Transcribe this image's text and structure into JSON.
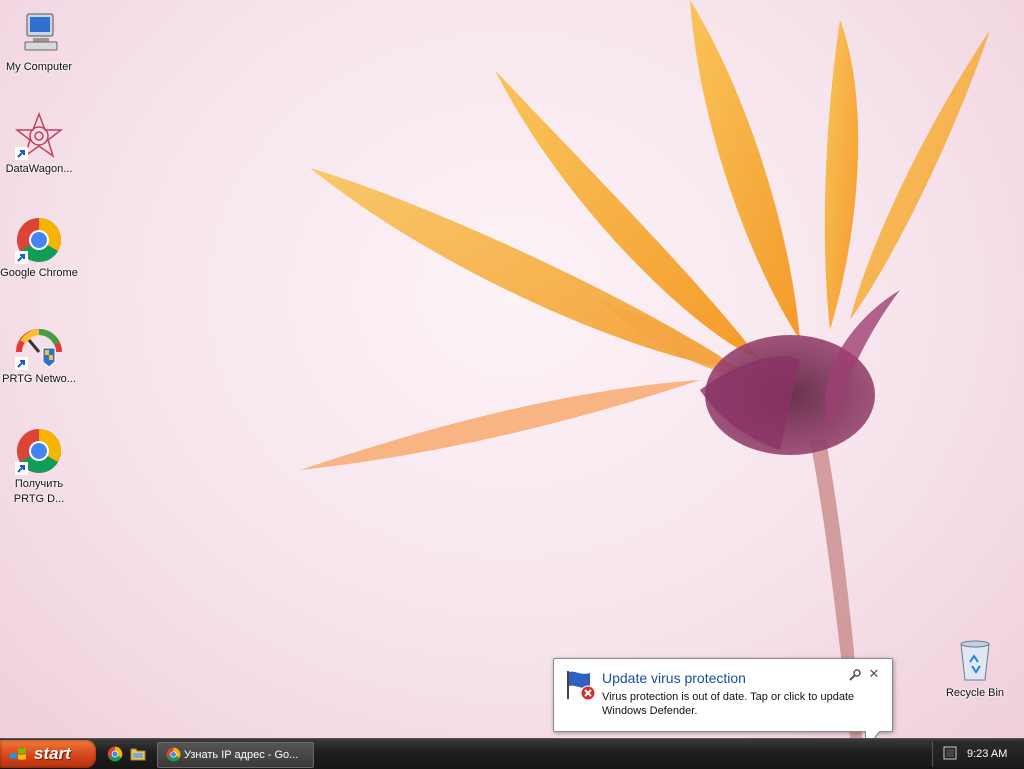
{
  "desktop": {
    "icons": [
      {
        "label": "My Computer",
        "icon": "my-computer-icon"
      },
      {
        "label": "DataWagon...",
        "icon": "datawagon-icon"
      },
      {
        "label": "Google Chrome",
        "icon": "chrome-icon"
      },
      {
        "label": "PRTG Netwo...",
        "icon": "prtg-icon"
      },
      {
        "label": "Получить PRTG D...",
        "icon": "chrome-icon"
      }
    ],
    "recycle_bin": {
      "label": "Recycle Bin",
      "icon": "recycle-bin-icon"
    }
  },
  "notification": {
    "title": "Update virus protection",
    "text": "Virus protection is out of date. Tap or click to update Windows Defender.",
    "icon": "windows-defender-warning-icon",
    "close_glyph": "✕"
  },
  "taskbar": {
    "start_label": "start",
    "quick_launch": [
      "chrome-icon",
      "folder-icon"
    ],
    "task_items": [
      {
        "label": "Узнать IP адрес - Go...",
        "icon": "chrome-icon"
      }
    ],
    "clock": "9:23 AM"
  },
  "colors": {
    "start_button": "#d5461b",
    "taskbar": "#202020",
    "balloon_title": "#1a4fa0"
  }
}
